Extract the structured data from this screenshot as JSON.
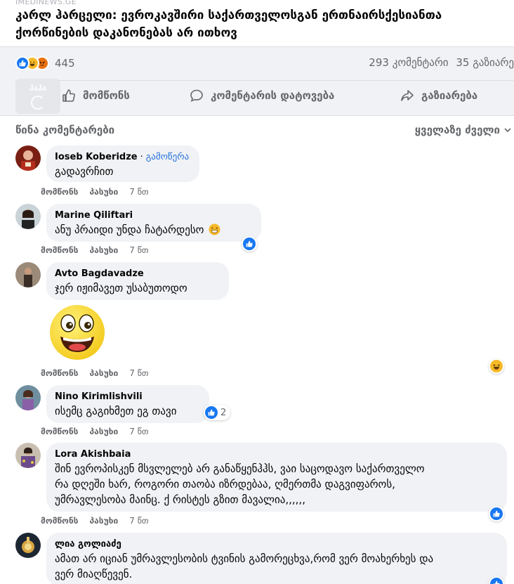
{
  "post": {
    "source": "IMEDINEWS.GE",
    "headline": "კარლ ჰარცელი: ევროკავშირი საქართველოსგან ერთნაირსქესიანთა ქორწინების დაკანონებას არ ითხოვ"
  },
  "stats": {
    "reaction_count": "445",
    "comments": "293 კომენტარი",
    "shares": "35 გაზიარე",
    "reaction_icons": [
      "like-icon",
      "haha-icon",
      "angry-icon"
    ]
  },
  "loader": {
    "label": "ჰაჰა"
  },
  "actions": {
    "like": "მომწონს",
    "comment": "კომენტარის დატოვება",
    "share": "გაზიარება"
  },
  "comments_header": {
    "previous": "წინა კომენტარები",
    "sort": "ყველაზე ძველი"
  },
  "meta_labels": {
    "like": "მომწონს",
    "reply": "პასუხი"
  },
  "comments": [
    {
      "author": "Ioseb Koberidze",
      "follow": "გამოწერა",
      "text": "გადავრჩით",
      "time": "7 წთ"
    },
    {
      "author": "Marine Qiliftari",
      "text": "ანუ პრაიდი უნდა ჩატარდესო",
      "time": "7 წთ"
    },
    {
      "author": "Avto Bagdavadze",
      "text": "ჯერ იჟიმავეთ უსაბუთოდო",
      "time": "7 წთ"
    },
    {
      "author": "Nino Kirimlishvili",
      "text": "ისემც გაგიხმეთ ეგ თავი",
      "time": "7 წთ",
      "reaction_count": "2"
    },
    {
      "author": "Lora Akishbaia",
      "text_lines": [
        "შინ ევროპისკენ მსვლელებ არ განაწყენჰჰს, ვაი საცოდავო საქართველო",
        "რა დღეში ხარ, როგორი თაობა იზრდებაა, ღმერთმა დაგვიფაროს,",
        "უმრავლესობა მაინც. ქ რისტეს გზით მავალია,,,,,,"
      ],
      "time": "7 წთ"
    },
    {
      "author": "ლია გოლიაძე",
      "text_lines": [
        "ამათ არ იციან უმრავლესობის ტვინის გამორეცხვა,რომ ვერ მოახერხეს და",
        "ვერ მიაღწევენ."
      ]
    }
  ],
  "colors": {
    "accent": "#1877f2",
    "link": "#216fdb",
    "bubble": "#f0f2f5",
    "muted": "#65676b"
  }
}
